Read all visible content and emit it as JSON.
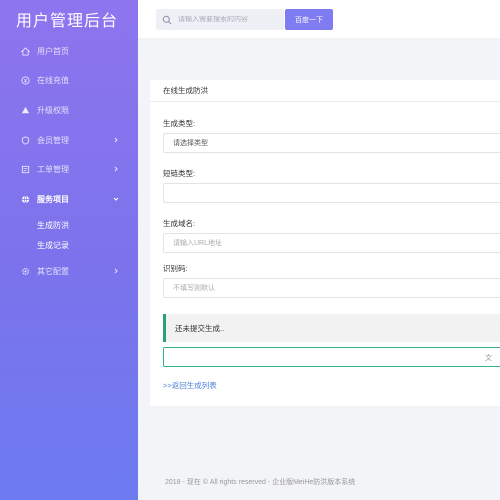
{
  "app": {
    "title": "用户管理后台"
  },
  "search": {
    "placeholder": "请输入需要搜索的内容",
    "button": "百度一下"
  },
  "sidebar": {
    "items": [
      {
        "label": "用户首页",
        "icon": "home-icon"
      },
      {
        "label": "在线充值",
        "icon": "recharge-icon"
      },
      {
        "label": "升级权限",
        "icon": "upgrade-icon"
      },
      {
        "label": "会员管理",
        "icon": "shield-icon"
      },
      {
        "label": "工单管理",
        "icon": "ticket-icon"
      },
      {
        "label": "服务项目",
        "icon": "globe-icon"
      },
      {
        "label": "其它配置",
        "icon": "gear-icon"
      }
    ],
    "sub_items": [
      {
        "label": "生成防洪"
      },
      {
        "label": "生成记录"
      }
    ]
  },
  "card": {
    "title": "在线生成防洪",
    "gen_type_label": "生成类型:",
    "gen_type_value": "请选择类型",
    "short_type_label": "短链类型:",
    "short_type_value": "",
    "domain_label": "生成域名:",
    "domain_placeholder": "请输入URL地址",
    "code_label": "识别码:",
    "code_placeholder": "不填写则默认",
    "alert_text": "还未提交生成..",
    "output_mark": "文",
    "back_link": ">>返回生成列表"
  },
  "footer": {
    "text": "2018 - 现在 © All rights reserved - 企业版MeiHe防洪版本系统"
  },
  "colors": {
    "accent": "#7f7cf2",
    "success": "#29a07d",
    "link": "#4a7fd8"
  }
}
